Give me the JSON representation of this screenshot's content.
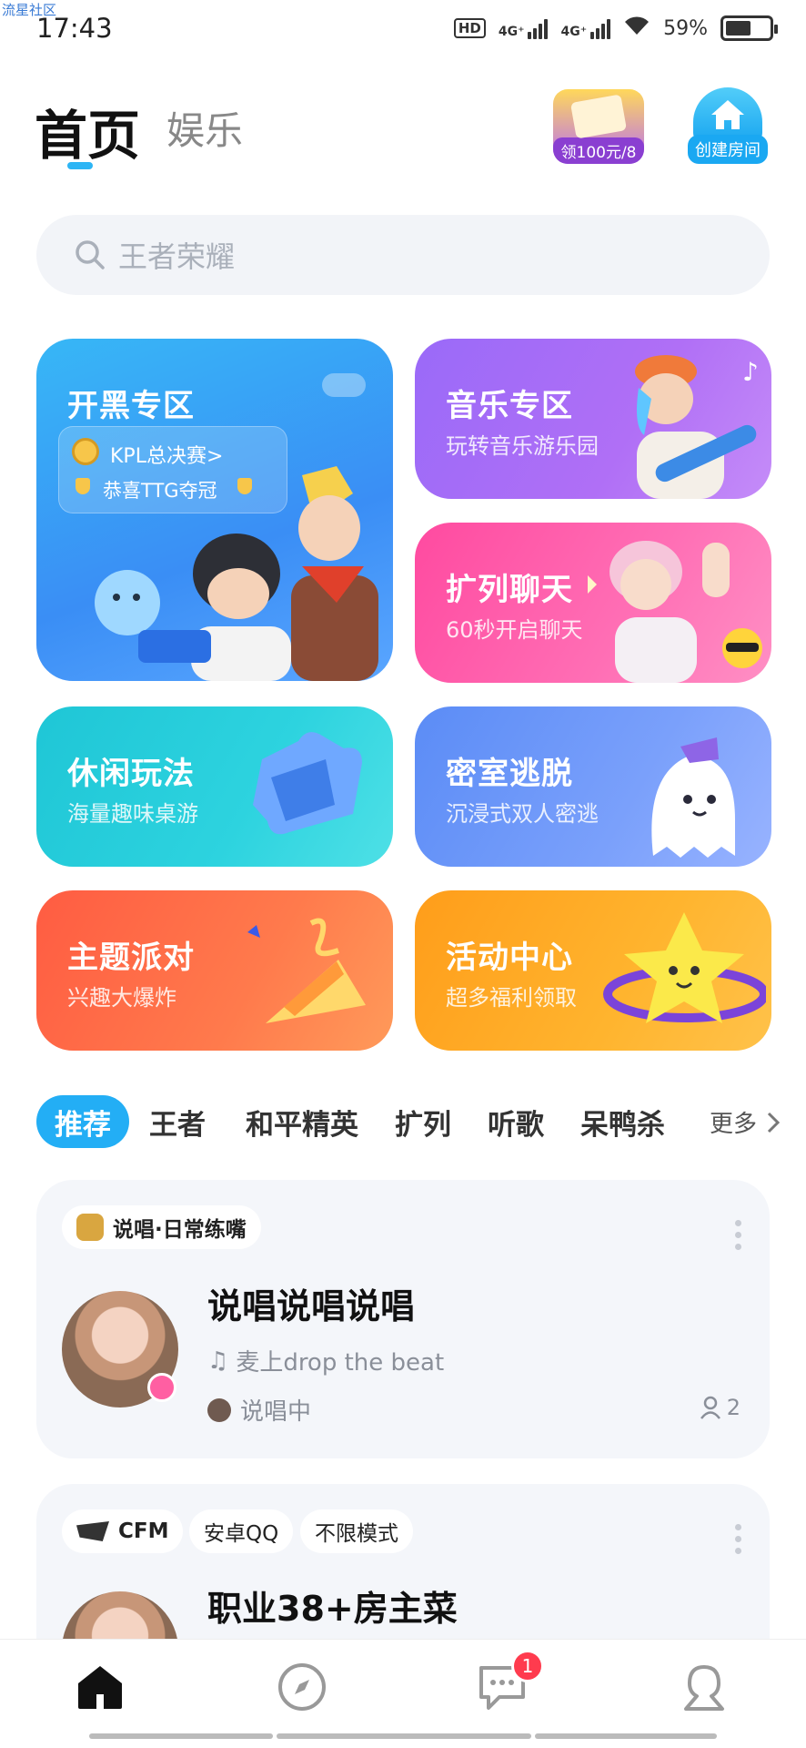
{
  "watermark": "流星社区",
  "status_bar": {
    "time": "17:43",
    "battery": "59%",
    "battery_level": 0.59,
    "network_1": "4G⁺",
    "network_2": "4G⁺",
    "hd": "HD"
  },
  "header": {
    "tab_active": "首页",
    "tab_inactive": "娱乐",
    "promo_label": "领100元/8",
    "create_room_label": "创建房间"
  },
  "search": {
    "placeholder": "王者荣耀"
  },
  "cards": [
    {
      "title": "开黑专区",
      "subtitle": "",
      "kpl_line1": "KPL总决赛>",
      "kpl_line2": "恭喜TTG夺冠"
    },
    {
      "title": "音乐专区",
      "subtitle": "玩转音乐游乐园"
    },
    {
      "title": "扩列聊天",
      "subtitle": "60秒开启聊天"
    },
    {
      "title": "休闲玩法",
      "subtitle": "海量趣味桌游"
    },
    {
      "title": "密室逃脱",
      "subtitle": "沉浸式双人密逃"
    },
    {
      "title": "主题派对",
      "subtitle": "兴趣大爆炸"
    },
    {
      "title": "活动中心",
      "subtitle": "超多福利领取"
    }
  ],
  "categories": {
    "active": "推荐",
    "items": [
      "王者",
      "和平精英",
      "扩列",
      "听歌",
      "呆鸭杀"
    ],
    "more": "更多"
  },
  "rooms": [
    {
      "tags": [
        "说唱·日常练嘴"
      ],
      "title": "说唱说唱说唱",
      "subtitle": "麦上drop the beat",
      "status": "说唱中",
      "members": "2"
    },
    {
      "tags": [
        "CFM",
        "安卓QQ",
        "不限模式"
      ],
      "title": "职业38+房主菜"
    }
  ],
  "bottom_nav": {
    "items": [
      "home-icon",
      "compass-icon",
      "message-icon",
      "profile-icon"
    ],
    "message_badge": "1"
  },
  "colors": {
    "accent": "#23aef5",
    "badge": "#ff3b4e"
  }
}
